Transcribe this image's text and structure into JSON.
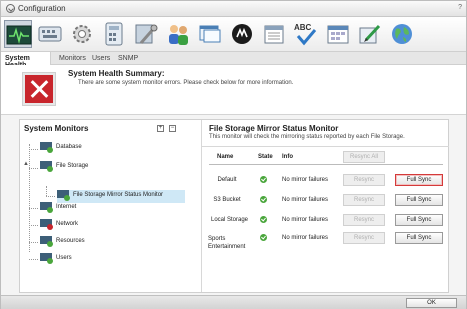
{
  "window": {
    "title": "Configuration",
    "help": "?"
  },
  "toolbar": {
    "icons": [
      {
        "name": "system-health-icon",
        "selected": true
      },
      {
        "name": "keyboard-icon"
      },
      {
        "name": "gear-icon"
      },
      {
        "name": "calculator-icon"
      },
      {
        "name": "tools-icon"
      },
      {
        "name": "users-icon"
      },
      {
        "name": "windows-icon"
      },
      {
        "name": "media-icon"
      },
      {
        "name": "calendar-icon"
      },
      {
        "name": "spellcheck-icon"
      },
      {
        "name": "calendar-grid-icon"
      },
      {
        "name": "edit-icon"
      },
      {
        "name": "globe-icon"
      }
    ]
  },
  "tabs": [
    "System Health",
    "Monitors",
    "Users",
    "SNMP"
  ],
  "summary": {
    "title": "System Health Summary:",
    "message": "There are some system monitor errors. Please check below for more information."
  },
  "monitors": {
    "title": "System Monitors",
    "expand_all": "+",
    "collapse_all": "−",
    "tree": [
      {
        "label": "Database",
        "status": "ok"
      },
      {
        "label": "File Storage",
        "status": "ok",
        "expanded": true
      },
      {
        "label": "File Storage Mirror Status Monitor",
        "status": "ok",
        "selected": true
      },
      {
        "label": "Internet",
        "status": "ok"
      },
      {
        "label": "Network",
        "status": "error"
      },
      {
        "label": "Resources",
        "status": "ok"
      },
      {
        "label": "Users",
        "status": "ok"
      }
    ]
  },
  "detail": {
    "title": "File Storage Mirror Status Monitor",
    "subtitle": "This monitor will check the mirroring status reported by each File Storage.",
    "columns": {
      "name": "Name",
      "state": "State",
      "info": "Info"
    },
    "resync_all": "Resync All",
    "rows": [
      {
        "name": "Default",
        "info": "No mirror failures",
        "resync": "Resync",
        "full_sync": "Full Sync"
      },
      {
        "name": "S3 Bucket",
        "info": "No mirror failures",
        "resync": "Resync",
        "full_sync": "Full Sync"
      },
      {
        "name": "Local Storage",
        "info": "No mirror failures",
        "resync": "Resync",
        "full_sync": "Full Sync"
      },
      {
        "name": "Sports Entertainment",
        "info": "No mirror failures",
        "resync": "Resync",
        "full_sync": "Full Sync"
      }
    ]
  },
  "footer": {
    "ok": "OK"
  },
  "colors": {
    "error": "#c8252c",
    "ok": "#4aa63c",
    "selected_row": "#cfe8f6",
    "focus_border": "#d43a3a"
  }
}
